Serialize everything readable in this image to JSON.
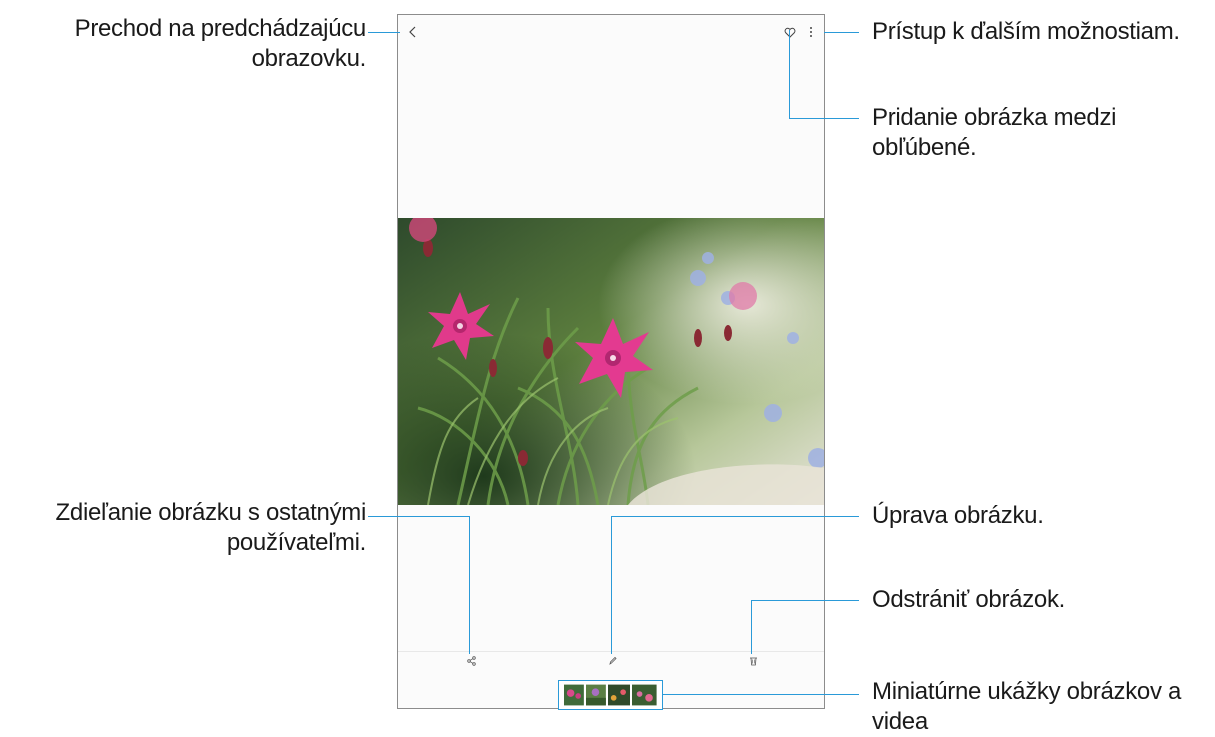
{
  "callouts": {
    "back": "Prechod na predchádzajúcu obrazovku.",
    "more": "Prístup k ďalším možnostiam.",
    "favorite": "Pridanie obrázka medzi obľúbené.",
    "share": "Zdieľanie obrázku s ostatnými používateľmi.",
    "edit": "Úprava obrázku.",
    "delete": "Odstrániť obrázok.",
    "thumbnails": "Miniatúrne ukážky obrázkov a videa"
  },
  "icons": {
    "back": "back-arrow-icon",
    "favorite": "heart-icon",
    "more": "more-options-icon",
    "share": "share-icon",
    "edit": "pencil-icon",
    "delete": "trash-icon"
  },
  "colors": {
    "callout_line": "#2a9ad8",
    "frame": "#8c8c8c"
  }
}
